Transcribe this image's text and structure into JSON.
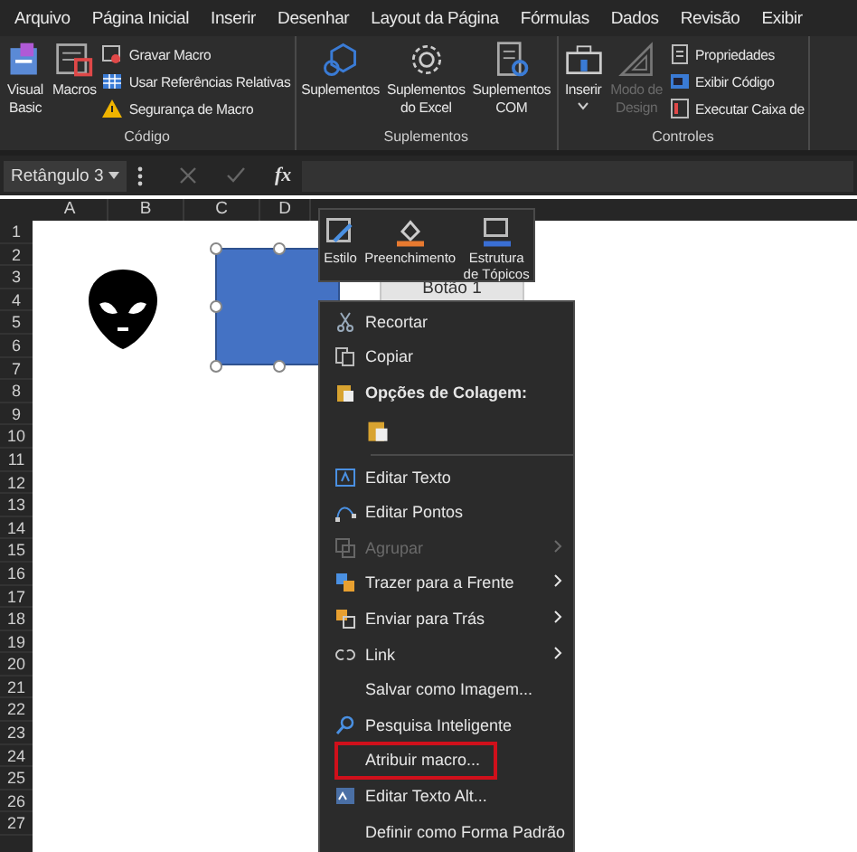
{
  "menu_tabs": [
    "Arquivo",
    "Página Inicial",
    "Inserir",
    "Desenhar",
    "Layout da Página",
    "Fórmulas",
    "Dados",
    "Revisão",
    "Exibir"
  ],
  "ribbon": {
    "groups": [
      {
        "label": "Código",
        "large": [
          {
            "label": "Visual\nBasic",
            "disabled": false,
            "dropdown": false
          },
          {
            "label": "Macros",
            "disabled": false,
            "dropdown": false
          }
        ],
        "small": [
          {
            "label": "Gravar Macro",
            "disabled": false
          },
          {
            "label": "Usar Referências Relativas",
            "disabled": false
          },
          {
            "label": "Segurança de Macro",
            "disabled": false
          }
        ]
      },
      {
        "label": "Suplementos",
        "large": [
          {
            "label": "Suplementos",
            "disabled": false,
            "dropdown": false
          },
          {
            "label": "Suplementos\ndo Excel",
            "disabled": false,
            "dropdown": false
          },
          {
            "label": "Suplementos\nCOM",
            "disabled": false,
            "dropdown": false
          }
        ]
      },
      {
        "label": "Controles",
        "large": [
          {
            "label": "Inserir",
            "disabled": false,
            "dropdown": true
          },
          {
            "label": "Modo de\nDesign",
            "disabled": true,
            "dropdown": false
          }
        ],
        "small": [
          {
            "label": "Propriedades",
            "disabled": false
          },
          {
            "label": "Exibir Código",
            "disabled": false
          },
          {
            "label": "Executar Caixa de",
            "disabled": false
          }
        ]
      }
    ]
  },
  "formula_bar": {
    "name_box": "Retângulo 3",
    "fx": "fx"
  },
  "sheet": {
    "columns": [
      "A",
      "B",
      "C",
      "D"
    ],
    "rows": [
      "1",
      "2",
      "3",
      "4",
      "5",
      "6",
      "7",
      "8",
      "9",
      "10",
      "11",
      "12",
      "13",
      "14",
      "15",
      "16",
      "17",
      "18",
      "19",
      "20",
      "21",
      "22",
      "23",
      "24",
      "25",
      "26",
      "27"
    ],
    "form_button": "Botão 1"
  },
  "mini_toolbar": [
    "Estilo",
    "Preenchimento",
    "Estrutura\nde Tópicos"
  ],
  "context_menu": [
    {
      "kind": "item",
      "label": "Recortar",
      "disabled": false,
      "submenu": false,
      "highlighted": false
    },
    {
      "kind": "item",
      "label": "Copiar",
      "disabled": false,
      "submenu": false,
      "highlighted": false
    },
    {
      "kind": "header",
      "label": "Opções de Colagem:"
    },
    {
      "kind": "paste"
    },
    {
      "kind": "item",
      "label": "Editar Texto",
      "disabled": false,
      "submenu": false,
      "highlighted": false
    },
    {
      "kind": "item",
      "label": "Editar Pontos",
      "disabled": false,
      "submenu": false,
      "highlighted": false
    },
    {
      "kind": "item",
      "label": "Agrupar",
      "disabled": true,
      "submenu": true,
      "highlighted": false
    },
    {
      "kind": "item",
      "label": "Trazer para a Frente",
      "disabled": false,
      "submenu": true,
      "highlighted": false
    },
    {
      "kind": "item",
      "label": "Enviar para Trás",
      "disabled": false,
      "submenu": true,
      "highlighted": false
    },
    {
      "kind": "item",
      "label": "Link",
      "disabled": false,
      "submenu": true,
      "highlighted": false
    },
    {
      "kind": "item",
      "label": "Salvar como Imagem...",
      "disabled": false,
      "submenu": false,
      "highlighted": false
    },
    {
      "kind": "item",
      "label": "Pesquisa Inteligente",
      "disabled": false,
      "submenu": false,
      "highlighted": false
    },
    {
      "kind": "item",
      "label": "Atribuir macro...",
      "disabled": false,
      "submenu": false,
      "highlighted": true
    },
    {
      "kind": "item",
      "label": "Editar Texto Alt...",
      "disabled": false,
      "submenu": false,
      "highlighted": false
    },
    {
      "kind": "item",
      "label": "Definir como Forma Padrão",
      "disabled": false,
      "submenu": false,
      "highlighted": false
    }
  ]
}
